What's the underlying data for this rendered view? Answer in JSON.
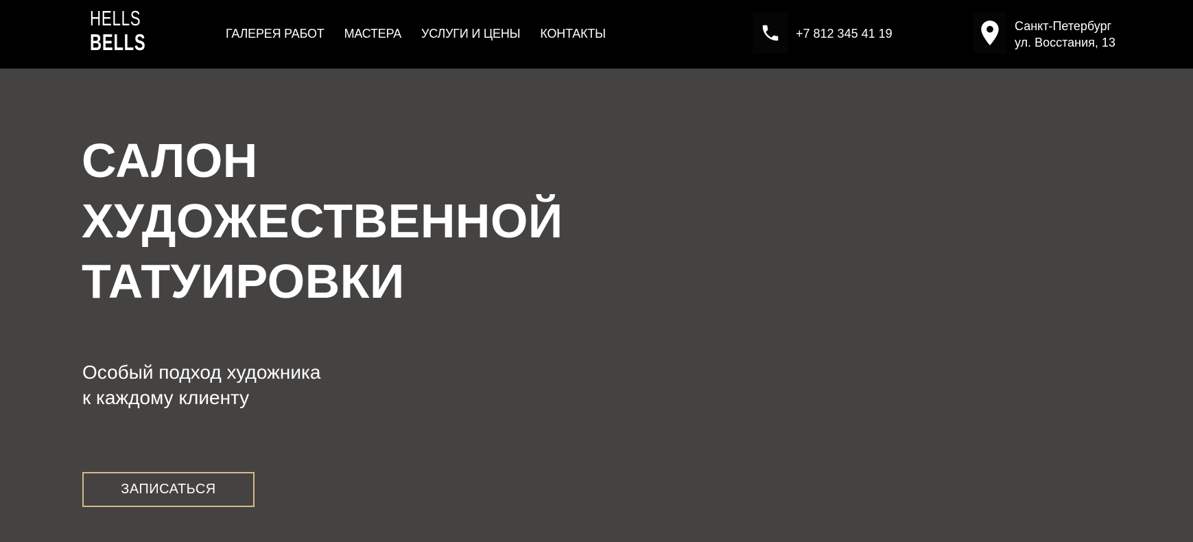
{
  "header": {
    "logo": {
      "line1": "HELLS",
      "line2": "BELLS"
    },
    "nav": [
      {
        "label": "ГАЛЕРЕЯ РАБОТ"
      },
      {
        "label": "МАСТЕРА"
      },
      {
        "label": "УСЛУГИ И ЦЕНЫ"
      },
      {
        "label": "КОНТАКТЫ"
      }
    ],
    "phone": {
      "icon": "phone-icon",
      "number": "+7 812 345 41 19"
    },
    "address": {
      "icon": "map-pin-icon",
      "city": "Санкт-Петербург",
      "street": "ул. Восстания, 13"
    }
  },
  "hero": {
    "title_lines": [
      "САЛОН",
      "ХУДОЖЕСТВЕННОЙ",
      "ТАТУИРОВКИ"
    ],
    "subtitle_lines": [
      "Особый подход художника",
      "к каждому клиенту"
    ],
    "cta_label": "ЗАПИСАТЬСЯ"
  },
  "colors": {
    "header_bg": "#000000",
    "hero_bg": "#454342",
    "text": "#ffffff",
    "cta_border": "#d7b98a"
  }
}
